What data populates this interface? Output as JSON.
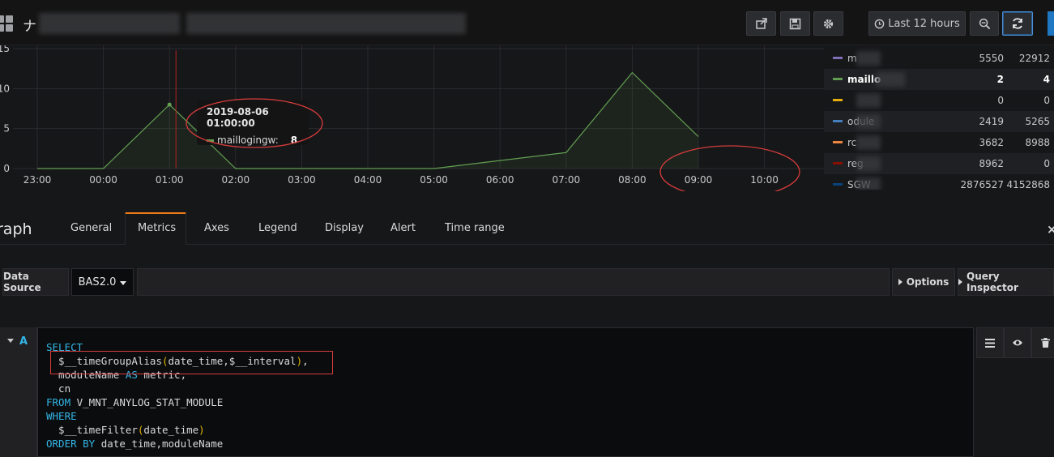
{
  "topbar": {
    "title_char": "ナ",
    "time_range_label": "Last 12 hours"
  },
  "graph": {
    "y_ticks": [
      "15",
      "10",
      "5",
      "0"
    ],
    "x_ticks": [
      "23:00",
      "00:00",
      "01:00",
      "02:00",
      "03:00",
      "04:00",
      "05:00",
      "06:00",
      "07:00",
      "08:00",
      "09:00",
      "10:00"
    ],
    "series_color": "#629e51",
    "tooltip": {
      "time": "2019-08-06 01:00:00",
      "series": "maillogingw:",
      "value": "8"
    }
  },
  "chart_data": {
    "type": "area",
    "x": [
      "23:00",
      "00:00",
      "01:00",
      "02:00",
      "03:00",
      "04:00",
      "05:00",
      "06:00",
      "07:00",
      "08:00",
      "09:00"
    ],
    "series": [
      {
        "name": "maillogingw",
        "values": [
          0,
          0,
          8,
          0,
          0,
          0,
          0,
          1,
          2,
          12,
          4
        ]
      }
    ],
    "ylim": [
      0,
      15
    ],
    "grid": true
  },
  "legend": {
    "rows": [
      {
        "name": "m",
        "v1": "5550",
        "v2": "22912",
        "color": "#806eb7",
        "bold": false
      },
      {
        "name": "maillo",
        "v1": "2",
        "v2": "4",
        "color": "#629e51",
        "bold": true
      },
      {
        "name": "",
        "v1": "0",
        "v2": "0",
        "color": "#e5ac0e",
        "bold": false
      },
      {
        "name": "odule",
        "v1": "2419",
        "v2": "5265",
        "color": "#447ebc",
        "bold": false
      },
      {
        "name": "rc",
        "v1": "3682",
        "v2": "8988",
        "color": "#ef843c",
        "bold": false
      },
      {
        "name": "reg",
        "v1": "8962",
        "v2": "0",
        "color": "#890f02",
        "bold": false
      },
      {
        "name": "SGW",
        "v1": "2876527",
        "v2": "4152868",
        "color": "#0a437c",
        "bold": false
      }
    ]
  },
  "editor": {
    "panel_type": "raph",
    "tabs": [
      "General",
      "Metrics",
      "Axes",
      "Legend",
      "Display",
      "Alert",
      "Time range"
    ],
    "active_tab": "Metrics",
    "close": "×"
  },
  "datasource": {
    "label": "Data Source",
    "value": "BAS2.0",
    "options_label": "Options",
    "inspector_label": "Query Inspector"
  },
  "query": {
    "ref": "A",
    "lines": {
      "l1_kw": "SELECT",
      "l2_fn": "  $__timeGroupAlias",
      "l2_open": "(",
      "l2_args": "date_time,$__interval",
      "l2_close": ")",
      "l2_tail": ",",
      "l3_a": "  moduleName ",
      "l3_kw": "AS",
      "l3_b": " metric,",
      "l4": "  cn",
      "l5_kw": "FROM",
      "l5_b": " V_MNT_ANYLOG_STAT_MODULE",
      "l6_kw": "WHERE",
      "l7_fn": "  $__timeFilter",
      "l7_open": "(",
      "l7_args": "date_time",
      "l7_close": ")",
      "l8_kw": "ORDER BY",
      "l8_b": " date_time,moduleName"
    }
  }
}
